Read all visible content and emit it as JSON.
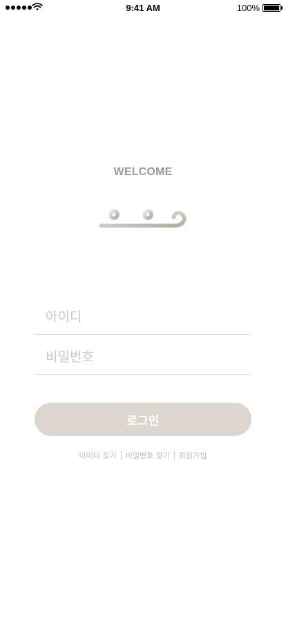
{
  "status_bar": {
    "time": "9:41 AM",
    "battery_percent": "100%",
    "signal_icon": "signal-dots-icon",
    "wifi_icon": "wifi-icon",
    "battery_icon": "battery-icon"
  },
  "welcome": "WELCOME",
  "logo": {
    "icon": "huu-logo-icon",
    "colors": {
      "light": "#e9e5df",
      "dark": "#b6ada2"
    }
  },
  "form": {
    "id_placeholder": "아이디",
    "password_placeholder": "비밀번호",
    "login_label": "로그인"
  },
  "links": {
    "find_id": "아이디 찾기",
    "find_password": "비밀번호 찾기",
    "signup": "회원가입"
  },
  "colors": {
    "button_bg": "#ddd6cf",
    "welcome_text": "#9b9b9b",
    "placeholder": "#c9c9c9"
  }
}
